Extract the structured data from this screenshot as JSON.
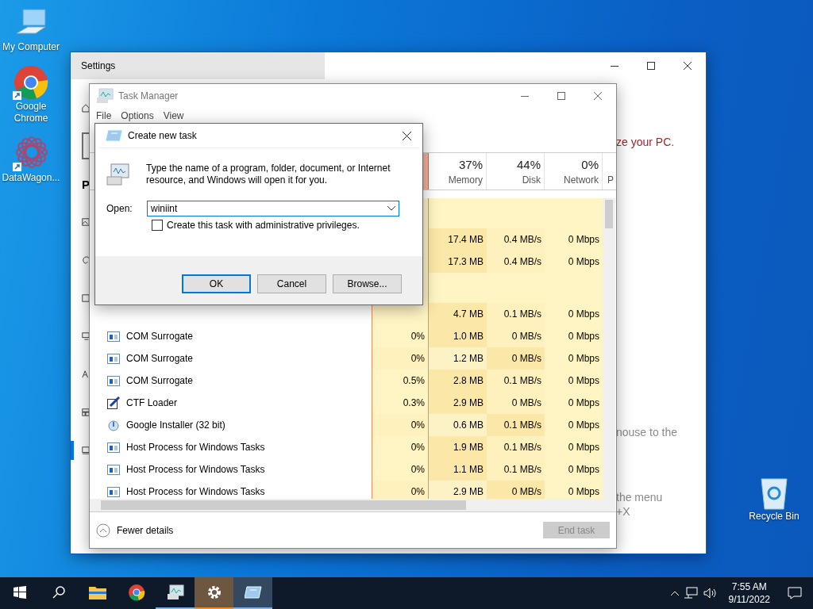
{
  "desktop_icons": [
    {
      "label": "My Computer",
      "kind": "computer"
    },
    {
      "label": "Google Chrome",
      "kind": "chrome"
    },
    {
      "label": "DataWagon...",
      "kind": "datawagon"
    }
  ],
  "recycle_bin": {
    "label": "Recycle Bin"
  },
  "settings": {
    "title": "Settings",
    "nav_heading": "P",
    "nav": [
      {
        "kind": "home",
        "selected": false
      },
      {
        "kind": "search",
        "selected": false
      },
      {
        "kind": "heading",
        "selected": false
      },
      {
        "kind": "picture",
        "selected": false
      },
      {
        "kind": "palette",
        "selected": false
      },
      {
        "kind": "square",
        "selected": false
      },
      {
        "kind": "lock",
        "selected": false
      },
      {
        "kind": "fonts",
        "selected": false
      },
      {
        "kind": "start",
        "selected": false
      },
      {
        "kind": "taskbar",
        "selected": true
      }
    ],
    "content": [
      {
        "text": "ze your PC.",
        "kind": "link"
      },
      {
        "text": "nouse to the",
        "kind": "note"
      },
      {
        "text": "the menu",
        "kind": "note"
      },
      {
        "text": "+X",
        "kind": "note"
      }
    ]
  },
  "task_manager": {
    "title": "Task Manager",
    "menu": [
      "File",
      "Options",
      "View"
    ],
    "columns": [
      {
        "kind": "cpu"
      },
      {
        "kind": "stat",
        "percent": "37%",
        "label": "Memory"
      },
      {
        "kind": "stat",
        "percent": "44%",
        "label": "Disk"
      },
      {
        "kind": "stat",
        "percent": "0%",
        "label": "Network"
      },
      {
        "kind": "cut",
        "label": "P"
      }
    ],
    "rows": [
      {
        "kind": "group"
      },
      {
        "kind": "stats",
        "memory": "17.4 MB",
        "disk": "0.4 MB/s",
        "network": "0 Mbps"
      },
      {
        "kind": "stats",
        "memory": "17.3 MB",
        "disk": "0.4 MB/s",
        "network": "0 Mbps"
      },
      {
        "kind": "group"
      },
      {
        "kind": "stats",
        "memory": "4.7 MB",
        "disk": "0.1 MB/s",
        "network": "0 Mbps"
      },
      {
        "kind": "window",
        "name": "COM Surrogate",
        "cpu": "0%",
        "memory": "1.0 MB",
        "disk": "0 MB/s",
        "network": "0 Mbps"
      },
      {
        "kind": "window",
        "name": "COM Surrogate",
        "cpu": "0%",
        "memory": "1.2 MB",
        "disk": "0 MB/s",
        "network": "0 Mbps"
      },
      {
        "kind": "window",
        "name": "COM Surrogate",
        "cpu": "0.5%",
        "memory": "2.8 MB",
        "disk": "0.1 MB/s",
        "network": "0 Mbps"
      },
      {
        "kind": "pen",
        "name": "CTF Loader",
        "cpu": "0.3%",
        "memory": "2.9 MB",
        "disk": "0 MB/s",
        "network": "0 Mbps"
      },
      {
        "kind": "installer",
        "name": "Google Installer (32 bit)",
        "cpu": "0%",
        "memory": "0.6 MB",
        "disk": "0.1 MB/s",
        "network": "0 Mbps"
      },
      {
        "kind": "window",
        "name": "Host Process for Windows Tasks",
        "cpu": "0%",
        "memory": "1.9 MB",
        "disk": "0.1 MB/s",
        "network": "0 Mbps"
      },
      {
        "kind": "window",
        "name": "Host Process for Windows Tasks",
        "cpu": "0%",
        "memory": "1.1 MB",
        "disk": "0.1 MB/s",
        "network": "0 Mbps"
      },
      {
        "kind": "window",
        "name": "Host Process for Windows Tasks",
        "cpu": "0%",
        "memory": "2.9 MB",
        "disk": "0 MB/s",
        "network": "0 Mbps"
      }
    ],
    "footer": {
      "toggle": "Fewer details",
      "end_task": {
        "label": "End task",
        "disabled": true
      }
    }
  },
  "dialog": {
    "title": "Create new task",
    "message": "Type the name of a program, folder, document, or Internet resource, and Windows will open it for you.",
    "open_label": "Open:",
    "value": "winiint",
    "checkbox": {
      "label": "Create this task with administrative privileges.",
      "checked": false
    },
    "buttons": [
      {
        "label": "OK",
        "selected": true
      },
      {
        "label": "Cancel",
        "selected": false
      },
      {
        "label": "Browse...",
        "selected": false
      }
    ]
  },
  "taskbar": {
    "items": [
      {
        "kind": "start",
        "active": false
      },
      {
        "kind": "search",
        "active": false
      },
      {
        "kind": "explorer",
        "active": false
      },
      {
        "kind": "chrome",
        "active": false
      },
      {
        "kind": "taskmgr",
        "active": false,
        "running": true
      },
      {
        "kind": "settings",
        "active": true,
        "running": true
      },
      {
        "kind": "run",
        "active": false,
        "running": true
      }
    ],
    "time": "7:55 AM",
    "date": "9/11/2022"
  }
}
